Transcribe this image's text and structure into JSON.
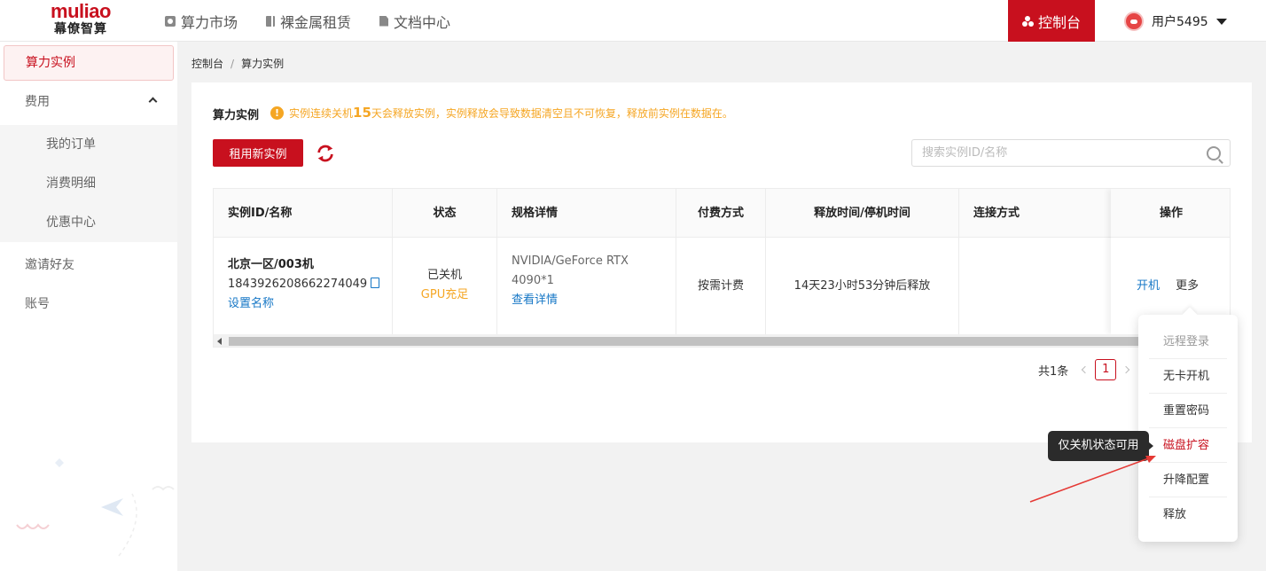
{
  "header": {
    "logo_en": "muliao",
    "logo_cn": "幕僚智算",
    "nav": [
      {
        "label": "算力市场",
        "icon": "camera-icon"
      },
      {
        "label": "裸金属租赁",
        "icon": "server-icon"
      },
      {
        "label": "文档中心",
        "icon": "document-icon"
      }
    ],
    "console_label": "控制台",
    "username": "用户5495"
  },
  "sidebar": {
    "items": [
      {
        "label": "算力实例",
        "active": true
      },
      {
        "label": "费用",
        "expanded": true
      },
      {
        "label": "我的订单"
      },
      {
        "label": "消费明细"
      },
      {
        "label": "优惠中心"
      },
      {
        "label": "邀请好友"
      },
      {
        "label": "账号"
      }
    ]
  },
  "breadcrumb": {
    "items": [
      "控制台",
      "算力实例"
    ],
    "separator": "/"
  },
  "main": {
    "title": "算力实例",
    "warning_pre": "实例连续关机",
    "warning_num": "15",
    "warning_post": "天会释放实例，实例释放会导致数据清空且不可恢复，释放前实例在数据在。",
    "rent_button": "租用新实例",
    "search_placeholder": "搜索实例ID/名称"
  },
  "table": {
    "headers": [
      "实例ID/名称",
      "状态",
      "规格详情",
      "付费方式",
      "释放时间/停机时间",
      "连接方式",
      "操作"
    ],
    "rows": [
      {
        "name": "北京一区/003机",
        "id": "1843926208662274049",
        "set_name": "设置名称",
        "status": "已关机",
        "gpu_status": "GPU充足",
        "spec_line1": "NVIDIA/GeForce RTX",
        "spec_line2": "4090*1",
        "spec_link": "查看详情",
        "billing": "按需计费",
        "release": "14天23小时53分钟后释放",
        "connect": "",
        "action_start": "开机",
        "action_more": "更多"
      }
    ]
  },
  "pagination": {
    "total": "共1条",
    "current": "1"
  },
  "more_menu": {
    "items": [
      {
        "label": "远程登录",
        "state": "disabled"
      },
      {
        "label": "无卡开机",
        "state": "normal"
      },
      {
        "label": "重置密码",
        "state": "normal"
      },
      {
        "label": "磁盘扩容",
        "state": "highlighted"
      },
      {
        "label": "升降配置",
        "state": "normal"
      },
      {
        "label": "释放",
        "state": "normal"
      }
    ]
  },
  "tooltip": {
    "text": "仅关机状态可用"
  },
  "colors": {
    "brand": "#c8101e",
    "link": "#1677c6",
    "warning": "#f5a623",
    "background": "#f2f2f2"
  }
}
